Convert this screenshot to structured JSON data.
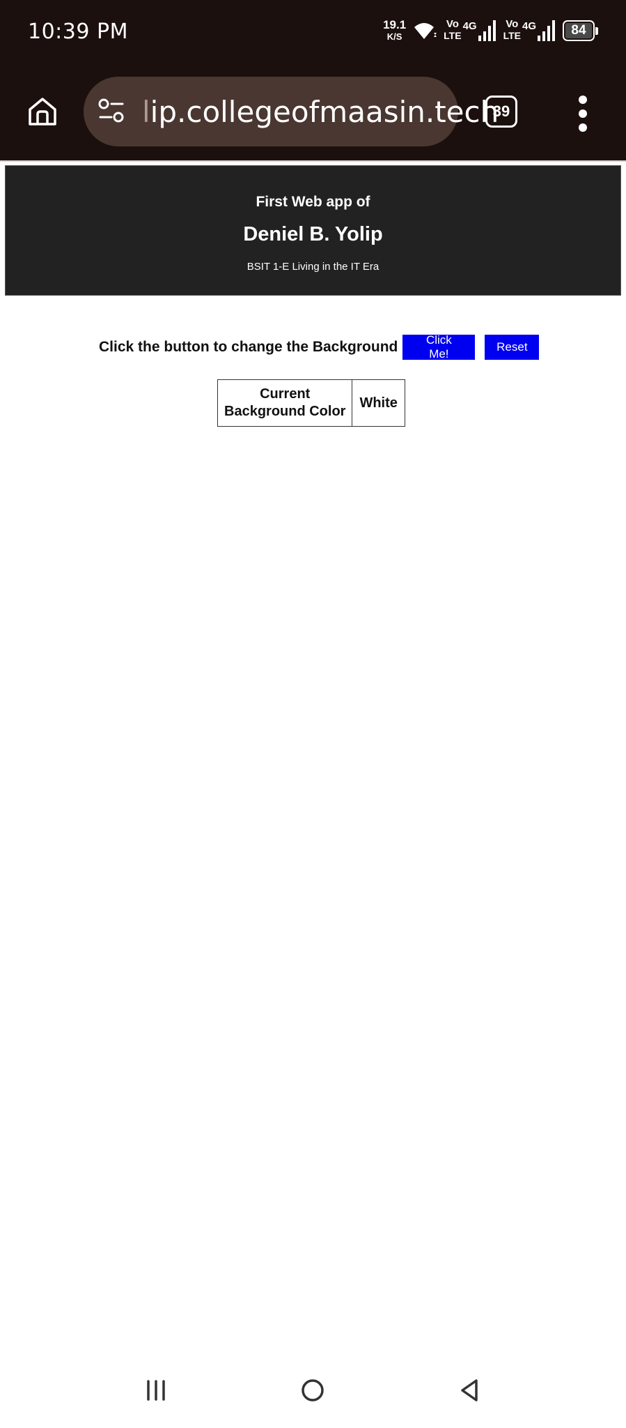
{
  "status_bar": {
    "time": "10:39 PM",
    "net_speed_value": "19.1",
    "net_speed_unit": "K/S",
    "sim1": {
      "volte_top": "Vo",
      "volte_bottom": "LTE",
      "gen": "4G"
    },
    "sim2": {
      "volte_top": "Vo",
      "volte_bottom": "LTE",
      "gen": "4G"
    },
    "battery_level": "84",
    "icons": [
      "wifi-icon",
      "signal-icon",
      "battery-icon"
    ]
  },
  "browser": {
    "url_dim_prefix": "l",
    "url_main": "ip.collegeofmaasin.tech",
    "tab_count": "39",
    "icons": [
      "home-icon",
      "site-settings-icon",
      "tab-switcher-icon",
      "more-vertical-icon"
    ]
  },
  "page": {
    "header": {
      "pretitle": "First Web app of",
      "name": "Deniel B. Yolip",
      "subtitle": "BSIT 1-E Living in the IT Era",
      "background": "#222222"
    },
    "prompt": "Click the button to change the Background",
    "click_button": "Click Me!",
    "reset_button": "Reset",
    "button_color": "#0000f0",
    "table": {
      "label_line1": "Current",
      "label_line2": "Background Color",
      "value": "White"
    }
  },
  "nav_bar": {
    "icons": [
      "recent-apps-icon",
      "home-circle-icon",
      "back-icon"
    ]
  },
  "colors": {
    "chrome_background": "#1c100e",
    "url_bar": "#4a3731",
    "page_background": "#ffffff"
  }
}
